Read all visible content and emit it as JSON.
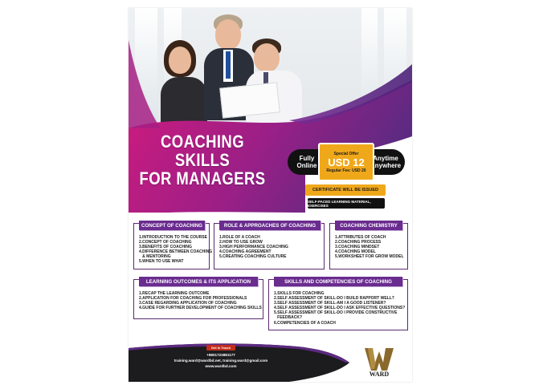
{
  "hero": {
    "title_line1": "COACHING SKILLS",
    "title_line2": "FOR MANAGERS"
  },
  "offer": {
    "fully": "Fully",
    "online": "Online",
    "special": "Special Offer",
    "price": "USD 12",
    "regular": "Regular Fee: USD 20",
    "anytime": "Anytime",
    "anywhere": "Anywhere",
    "certificate": "CERTIFICATE WILL BE ISSUED",
    "self_paced": "SELF-PACED LEARNING MATERIAL, EXERCISES"
  },
  "sections": {
    "concept": {
      "title": "CONCEPT OF COACHING",
      "items": [
        "1.INTRODUCTION TO THE COURSE",
        "2.CONCEPT OF COACHING",
        "3.BENEFITS OF COACHING",
        "4.DIFFERENCE BETWEEN COACHING",
        "   & MENTORING",
        "5.WHEN TO USE WHAT"
      ]
    },
    "role": {
      "title": "ROLE & APPROACHES OF COACHING",
      "items": [
        "1.ROLE OF A COACH",
        "2.HOW TO USE GROW",
        "3.HIGH PERFORMANCE COACHING",
        "4.COACHING AGREEMENT",
        "5.CREATING COACHING CULTURE"
      ]
    },
    "chemistry": {
      "title": "COACHING CHEMISTRY",
      "items": [
        "1.ATTRIBUTES OF COACH",
        "2.COACHING PROCESS",
        "3.COACHING MINDSET",
        "4.COACHING MODEL",
        "5.WORKSHEET FOR GROW MODEL"
      ]
    },
    "outcomes": {
      "title": "LEARNING OUTCOMES & ITS APPLICATION",
      "items": [
        "1.RECAP THE LEARNING OUTCOME",
        "2.APPLICATION FOR COACHING FOR PROFESSIONALS",
        "3.CASE REGARDING APPLICATION OF COACHING",
        "4.GUIDE FOR FURTHER DEVELOPMENT OF COACHING SKILLS"
      ]
    },
    "skills": {
      "title": "SKILLS AND COMPETENCIES OF COACHING",
      "items": [
        "1.SKILLS FOR COACHING",
        "2.SELF ASSESSMENT OF SKILL-DO I BUILD RAPPORT WELL?",
        "3.SELF ASSESSMENT OF SKILL-AM I A GOOD LISTENER?",
        "4.SELF ASSESSMENT OF SKILL-DO I ASK EFFECTIVE QUESTIONS?",
        "5.SELF ASSESSMENT OF SKILL-DO I PROVIDE CONSTRUCTIVE",
        "   FEEDBACK?",
        "6.COMPETENCIES OF A COACH"
      ]
    }
  },
  "contact": {
    "touch": "Get In Touch",
    "phone": "+8801723881177",
    "emails": "training.ward@wardbd.net, training.ward@gmail.com",
    "website": "www.wardbd.com"
  },
  "logo": {
    "text": "WARD"
  },
  "colors": {
    "purple": "#6a2c8f",
    "magenta": "#c2187a",
    "orange": "#f0a81b",
    "dark": "#111111"
  }
}
